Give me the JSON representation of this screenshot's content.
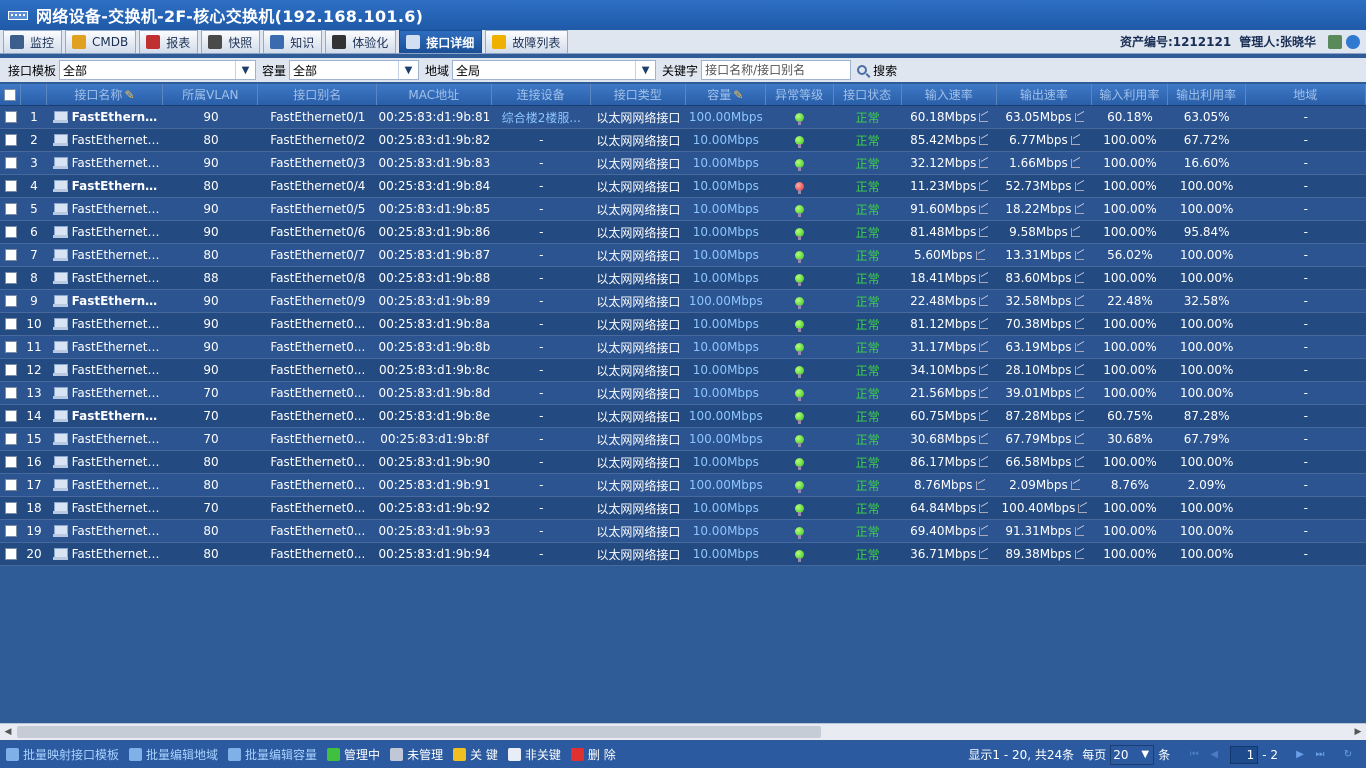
{
  "window": {
    "title": "网络设备-交换机-2F-核心交换机(192.168.101.6)"
  },
  "tabs": [
    {
      "label": "监控",
      "icon": "monitor-icon",
      "color": "#3b5e8c"
    },
    {
      "label": "CMDB",
      "icon": "cmdb-icon",
      "color": "#e0a020"
    },
    {
      "label": "报表",
      "icon": "report-icon",
      "color": "#c03030"
    },
    {
      "label": "快照",
      "icon": "snapshot-icon",
      "color": "#4a4a4a"
    },
    {
      "label": "知识",
      "icon": "knowledge-icon",
      "color": "#3a6ab0"
    },
    {
      "label": "体验化",
      "icon": "experience-icon",
      "color": "#333333"
    },
    {
      "label": "接口详细",
      "icon": "interface-detail-icon",
      "color": "#d0dff2",
      "active": true
    },
    {
      "label": "故障列表",
      "icon": "warning-icon",
      "color": "#f0b000"
    }
  ],
  "meta": {
    "asset_no": "资产编号:1212121",
    "manager": "管理人:张晓华"
  },
  "filters": {
    "template_label": "接口模板",
    "template_value": "全部",
    "capacity_label": "容量",
    "capacity_value": "全部",
    "region_label": "地域",
    "region_value": "全局",
    "keyword_label": "关键字",
    "keyword_placeholder": "接口名称/接口别名",
    "search_label": "搜索"
  },
  "columns": [
    "接口名称",
    "所属VLAN",
    "接口别名",
    "MAC地址",
    "连接设备",
    "接口类型",
    "容量",
    "异常等级",
    "接口状态",
    "输入速率",
    "输出速率",
    "输入利用率",
    "输出利用率",
    "地域"
  ],
  "rows": [
    {
      "no": "1",
      "name": "FastEthernet0/1",
      "vlan": "90",
      "alias": "FastEthernet0/1",
      "mac": "00:25:83:d1:9b:81",
      "device": "综合楼2楼服...",
      "type": "以太网网络接口",
      "cap": "100.00Mbps",
      "level": "green",
      "status": "正常",
      "in": "60.18Mbps",
      "out": "63.05Mbps",
      "inu": "60.18%",
      "outu": "63.05%",
      "region": "-"
    },
    {
      "no": "2",
      "name": "FastEthernet0/2",
      "vlan": "80",
      "alias": "FastEthernet0/2",
      "mac": "00:25:83:d1:9b:82",
      "device": "-",
      "type": "以太网网络接口",
      "cap": "10.00Mbps",
      "level": "green",
      "status": "正常",
      "in": "85.42Mbps",
      "out": "6.77Mbps",
      "inu": "100.00%",
      "outu": "67.72%",
      "region": "-"
    },
    {
      "no": "3",
      "name": "FastEthernet0/3",
      "vlan": "90",
      "alias": "FastEthernet0/3",
      "mac": "00:25:83:d1:9b:83",
      "device": "-",
      "type": "以太网网络接口",
      "cap": "10.00Mbps",
      "level": "green",
      "status": "正常",
      "in": "32.12Mbps",
      "out": "1.66Mbps",
      "inu": "100.00%",
      "outu": "16.60%",
      "region": "-"
    },
    {
      "no": "4",
      "name": "FastEthernet0/4",
      "vlan": "80",
      "alias": "FastEthernet0/4",
      "mac": "00:25:83:d1:9b:84",
      "device": "-",
      "type": "以太网网络接口",
      "cap": "10.00Mbps",
      "level": "red",
      "status": "正常",
      "in": "11.23Mbps",
      "out": "52.73Mbps",
      "inu": "100.00%",
      "outu": "100.00%",
      "region": "-"
    },
    {
      "no": "5",
      "name": "FastEthernet0/5",
      "vlan": "90",
      "alias": "FastEthernet0/5",
      "mac": "00:25:83:d1:9b:85",
      "device": "-",
      "type": "以太网网络接口",
      "cap": "10.00Mbps",
      "level": "green",
      "status": "正常",
      "in": "91.60Mbps",
      "out": "18.22Mbps",
      "inu": "100.00%",
      "outu": "100.00%",
      "region": "-"
    },
    {
      "no": "6",
      "name": "FastEthernet0/6",
      "vlan": "90",
      "alias": "FastEthernet0/6",
      "mac": "00:25:83:d1:9b:86",
      "device": "-",
      "type": "以太网网络接口",
      "cap": "10.00Mbps",
      "level": "green",
      "status": "正常",
      "in": "81.48Mbps",
      "out": "9.58Mbps",
      "inu": "100.00%",
      "outu": "95.84%",
      "region": "-"
    },
    {
      "no": "7",
      "name": "FastEthernet0/7",
      "vlan": "80",
      "alias": "FastEthernet0/7",
      "mac": "00:25:83:d1:9b:87",
      "device": "-",
      "type": "以太网网络接口",
      "cap": "10.00Mbps",
      "level": "green",
      "status": "正常",
      "in": "5.60Mbps",
      "out": "13.31Mbps",
      "inu": "56.02%",
      "outu": "100.00%",
      "region": "-"
    },
    {
      "no": "8",
      "name": "FastEthernet0/8",
      "vlan": "88",
      "alias": "FastEthernet0/8",
      "mac": "00:25:83:d1:9b:88",
      "device": "-",
      "type": "以太网网络接口",
      "cap": "10.00Mbps",
      "level": "green",
      "status": "正常",
      "in": "18.41Mbps",
      "out": "83.60Mbps",
      "inu": "100.00%",
      "outu": "100.00%",
      "region": "-"
    },
    {
      "no": "9",
      "name": "FastEthernet0/9",
      "vlan": "90",
      "alias": "FastEthernet0/9",
      "mac": "00:25:83:d1:9b:89",
      "device": "-",
      "type": "以太网网络接口",
      "cap": "100.00Mbps",
      "level": "green",
      "status": "正常",
      "in": "22.48Mbps",
      "out": "32.58Mbps",
      "inu": "22.48%",
      "outu": "32.58%",
      "region": "-"
    },
    {
      "no": "10",
      "name": "FastEthernet0/...",
      "vlan": "90",
      "alias": "FastEthernet0...",
      "mac": "00:25:83:d1:9b:8a",
      "device": "-",
      "type": "以太网网络接口",
      "cap": "10.00Mbps",
      "level": "green",
      "status": "正常",
      "in": "81.12Mbps",
      "out": "70.38Mbps",
      "inu": "100.00%",
      "outu": "100.00%",
      "region": "-"
    },
    {
      "no": "11",
      "name": "FastEthernet0/...",
      "vlan": "90",
      "alias": "FastEthernet0...",
      "mac": "00:25:83:d1:9b:8b",
      "device": "-",
      "type": "以太网网络接口",
      "cap": "10.00Mbps",
      "level": "green",
      "status": "正常",
      "in": "31.17Mbps",
      "out": "63.19Mbps",
      "inu": "100.00%",
      "outu": "100.00%",
      "region": "-"
    },
    {
      "no": "12",
      "name": "FastEthernet0/...",
      "vlan": "90",
      "alias": "FastEthernet0...",
      "mac": "00:25:83:d1:9b:8c",
      "device": "-",
      "type": "以太网网络接口",
      "cap": "10.00Mbps",
      "level": "green",
      "status": "正常",
      "in": "34.10Mbps",
      "out": "28.10Mbps",
      "inu": "100.00%",
      "outu": "100.00%",
      "region": "-"
    },
    {
      "no": "13",
      "name": "FastEthernet0/...",
      "vlan": "70",
      "alias": "FastEthernet0...",
      "mac": "00:25:83:d1:9b:8d",
      "device": "-",
      "type": "以太网网络接口",
      "cap": "10.00Mbps",
      "level": "green",
      "status": "正常",
      "in": "21.56Mbps",
      "out": "39.01Mbps",
      "inu": "100.00%",
      "outu": "100.00%",
      "region": "-"
    },
    {
      "no": "14",
      "name": "FastEthernet...",
      "vlan": "70",
      "alias": "FastEthernet0...",
      "mac": "00:25:83:d1:9b:8e",
      "device": "-",
      "type": "以太网网络接口",
      "cap": "100.00Mbps",
      "level": "green",
      "status": "正常",
      "in": "60.75Mbps",
      "out": "87.28Mbps",
      "inu": "60.75%",
      "outu": "87.28%",
      "region": "-"
    },
    {
      "no": "15",
      "name": "FastEthernet0/...",
      "vlan": "70",
      "alias": "FastEthernet0...",
      "mac": "00:25:83:d1:9b:8f",
      "device": "-",
      "type": "以太网网络接口",
      "cap": "100.00Mbps",
      "level": "green",
      "status": "正常",
      "in": "30.68Mbps",
      "out": "67.79Mbps",
      "inu": "30.68%",
      "outu": "67.79%",
      "region": "-"
    },
    {
      "no": "16",
      "name": "FastEthernet0/...",
      "vlan": "80",
      "alias": "FastEthernet0...",
      "mac": "00:25:83:d1:9b:90",
      "device": "-",
      "type": "以太网网络接口",
      "cap": "10.00Mbps",
      "level": "green",
      "status": "正常",
      "in": "86.17Mbps",
      "out": "66.58Mbps",
      "inu": "100.00%",
      "outu": "100.00%",
      "region": "-"
    },
    {
      "no": "17",
      "name": "FastEthernet0/...",
      "vlan": "80",
      "alias": "FastEthernet0...",
      "mac": "00:25:83:d1:9b:91",
      "device": "-",
      "type": "以太网网络接口",
      "cap": "100.00Mbps",
      "level": "green",
      "status": "正常",
      "in": "8.76Mbps",
      "out": "2.09Mbps",
      "inu": "8.76%",
      "outu": "2.09%",
      "region": "-"
    },
    {
      "no": "18",
      "name": "FastEthernet0/...",
      "vlan": "70",
      "alias": "FastEthernet0...",
      "mac": "00:25:83:d1:9b:92",
      "device": "-",
      "type": "以太网网络接口",
      "cap": "10.00Mbps",
      "level": "green",
      "status": "正常",
      "in": "64.84Mbps",
      "out": "100.40Mbps",
      "inu": "100.00%",
      "outu": "100.00%",
      "region": "-"
    },
    {
      "no": "19",
      "name": "FastEthernet0/...",
      "vlan": "80",
      "alias": "FastEthernet0...",
      "mac": "00:25:83:d1:9b:93",
      "device": "-",
      "type": "以太网网络接口",
      "cap": "10.00Mbps",
      "level": "green",
      "status": "正常",
      "in": "69.40Mbps",
      "out": "91.31Mbps",
      "inu": "100.00%",
      "outu": "100.00%",
      "region": "-"
    },
    {
      "no": "20",
      "name": "FastEthernet0/...",
      "vlan": "80",
      "alias": "FastEthernet0...",
      "mac": "00:25:83:d1:9b:94",
      "device": "-",
      "type": "以太网网络接口",
      "cap": "10.00Mbps",
      "level": "green",
      "status": "正常",
      "in": "36.71Mbps",
      "out": "89.38Mbps",
      "inu": "100.00%",
      "outu": "100.00%",
      "region": "-"
    }
  ],
  "bold_rows": [
    1,
    4,
    9,
    14
  ],
  "bottom": {
    "actions": [
      {
        "label": "批量映射接口模板",
        "icon": "map-template-icon",
        "color": "#7fb0e8",
        "blue": true
      },
      {
        "label": "批量编辑地域",
        "icon": "edit-region-icon",
        "color": "#7fb0e8",
        "blue": true
      },
      {
        "label": "批量编辑容量",
        "icon": "edit-capacity-icon",
        "color": "#7fb0e8",
        "blue": true
      },
      {
        "label": "管理中",
        "icon": "managed-icon",
        "color": "#3fc03f"
      },
      {
        "label": "未管理",
        "icon": "unmanaged-icon",
        "color": "#c0c8d8"
      },
      {
        "label": "关 键",
        "icon": "key-icon",
        "color": "#f0c020"
      },
      {
        "label": "非关键",
        "icon": "non-key-icon",
        "color": "#e8eef8"
      },
      {
        "label": "删 除",
        "icon": "delete-icon",
        "color": "#e03030"
      }
    ],
    "pager_info": "显示1 - 20, 共24条",
    "per_page_label": "每页",
    "per_page_value": "20",
    "per_page_unit": "条",
    "page_value": "1",
    "page_total": "- 2"
  }
}
